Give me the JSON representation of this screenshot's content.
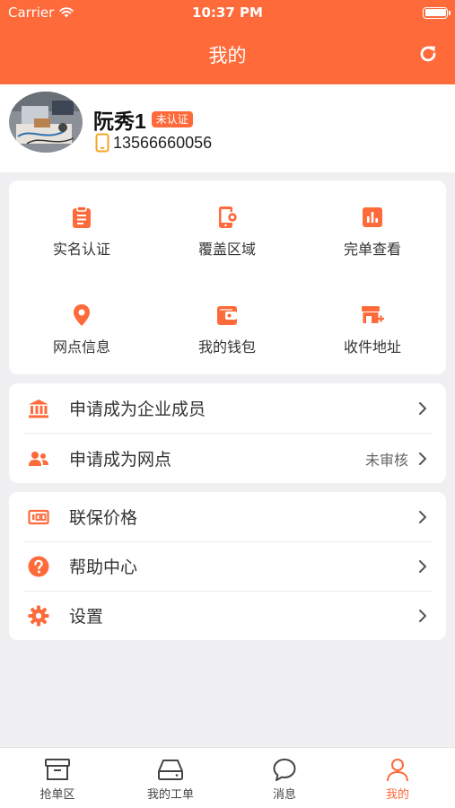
{
  "status_bar": {
    "carrier": "Carrier",
    "time": "10:37 PM"
  },
  "nav": {
    "title": "我的"
  },
  "profile": {
    "name": "阮秀1",
    "badge": "未认证",
    "phone": "13566660056"
  },
  "grid": [
    {
      "label": "实名认证",
      "icon": "clipboard-icon"
    },
    {
      "label": "覆盖区域",
      "icon": "phone-settings-icon"
    },
    {
      "label": "完单查看",
      "icon": "bar-chart-icon"
    },
    {
      "label": "网点信息",
      "icon": "location-pin-icon"
    },
    {
      "label": "我的钱包",
      "icon": "wallet-icon"
    },
    {
      "label": "收件地址",
      "icon": "store-add-icon"
    }
  ],
  "apply_list": [
    {
      "label": "申请成为企业成员",
      "status": "",
      "icon": "bank-icon"
    },
    {
      "label": "申请成为网点",
      "status": "未审核",
      "icon": "people-icon"
    }
  ],
  "misc_list": [
    {
      "label": "联保价格",
      "icon": "price-tag-icon"
    },
    {
      "label": "帮助中心",
      "icon": "help-icon"
    },
    {
      "label": "设置",
      "icon": "gear-icon"
    }
  ],
  "tabs": [
    {
      "label": "抢单区",
      "icon": "archive-box-icon",
      "active": false
    },
    {
      "label": "我的工单",
      "icon": "hard-drive-icon",
      "active": false
    },
    {
      "label": "消息",
      "icon": "chat-bubble-icon",
      "active": false
    },
    {
      "label": "我的",
      "icon": "person-icon",
      "active": true
    }
  ],
  "colors": {
    "accent": "#fe6a3a",
    "background": "#f0f0f2"
  }
}
